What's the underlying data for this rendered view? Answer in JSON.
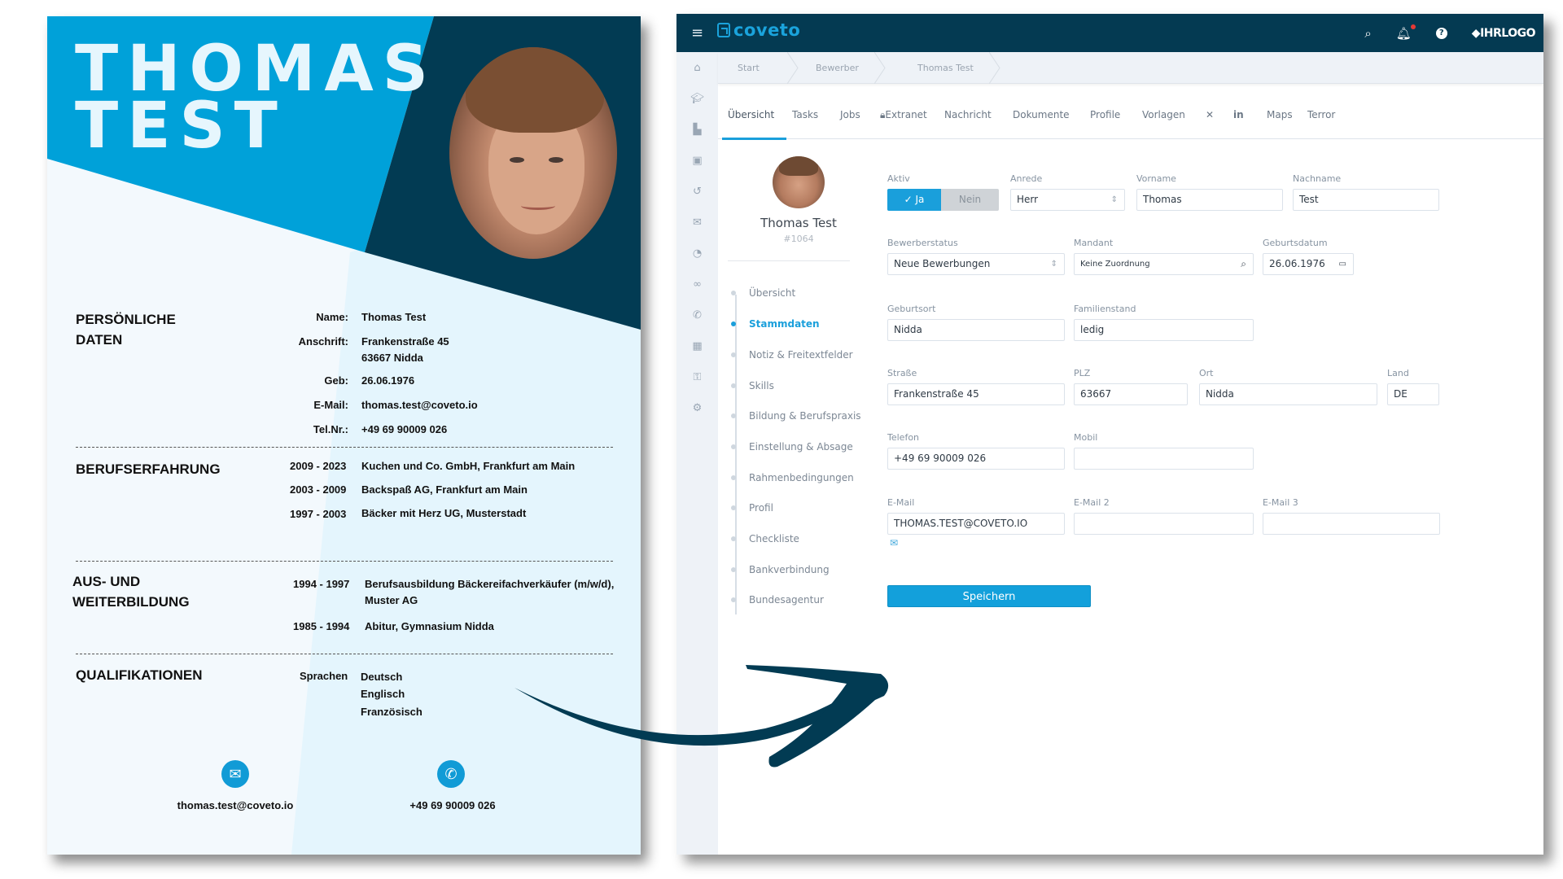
{
  "cv": {
    "first_name": "THOMAS",
    "last_name": "TEST",
    "colors": {
      "light_blue": "#00a1d9",
      "navy": "#023b53",
      "page_bg": "#f3f9fd",
      "pale": "#e4f5fd"
    },
    "personal": {
      "title_line1": "PERSÖNLICHE",
      "title_line2": "DATEN",
      "rows": [
        {
          "label": "Name:",
          "value": "Thomas Test"
        },
        {
          "label": "Anschrift:",
          "value": "Frankenstraße 45",
          "value2": "63667 Nidda"
        },
        {
          "label": "Geb:",
          "value": "26.06.1976"
        },
        {
          "label": "E-Mail:",
          "value": "thomas.test@coveto.io"
        },
        {
          "label": "Tel.Nr.:",
          "value": "+49 69 90009 026"
        }
      ]
    },
    "experience": {
      "title": "BERUFSERFAHRUNG",
      "rows": [
        {
          "years": "2009 - 2023",
          "text": "Kuchen und Co. GmbH, Frankfurt am Main"
        },
        {
          "years": "2003 - 2009",
          "text": "Backspaß AG, Frankfurt am Main"
        },
        {
          "years": "1997 - 2003",
          "text": "Bäcker mit Herz UG, Musterstadt"
        }
      ]
    },
    "education": {
      "title_line1": "AUS- UND",
      "title_line2": "WEITERBILDUNG",
      "rows": [
        {
          "years": "1994 - 1997",
          "text": "Berufsausbildung Bäckereifachverkäufer (m/w/d),",
          "text2": "Muster AG"
        },
        {
          "years": "1985 - 1994",
          "text": "Abitur, Gymnasium Nidda"
        }
      ]
    },
    "qualifications": {
      "title": "QUALIFIKATIONEN",
      "label": "Sprachen",
      "languages": [
        "Deutsch",
        "Englisch",
        "Französisch"
      ]
    },
    "footer": {
      "email_icon": "envelope-icon",
      "email": "thomas.test@coveto.io",
      "phone_icon": "phone-icon",
      "phone": "+49 69 90009 026"
    }
  },
  "app": {
    "brand": "coveto",
    "header_icons": [
      "menu-icon",
      "search-icon",
      "bell-icon",
      "help-icon"
    ],
    "customer_logo": "IHRLOGO",
    "colors": {
      "header": "#043a52",
      "accent": "#1a9fdb",
      "sidebar": "#eef2f7"
    },
    "sidebar_icons": [
      "home-icon",
      "graduation-cap-icon",
      "factory-icon",
      "contact-card-icon",
      "history-icon",
      "envelope-icon",
      "pie-chart-icon",
      "link-icon",
      "phone-icon",
      "calendar-icon",
      "user-lock-icon",
      "gears-icon"
    ],
    "breadcrumb": [
      "Start",
      "Bewerber",
      "Thomas Test"
    ],
    "tabs": [
      {
        "label": "Übersicht",
        "active": true
      },
      {
        "label": "Tasks"
      },
      {
        "label": "Jobs"
      },
      {
        "label": "Extranet",
        "icon": "lock-icon"
      },
      {
        "label": "Nachricht"
      },
      {
        "label": "Dokumente"
      },
      {
        "label": "Profile"
      },
      {
        "label": "Vorlagen"
      },
      {
        "label": "",
        "icon": "xing-icon"
      },
      {
        "label": "in",
        "icon": "linkedin-icon"
      },
      {
        "label": "Maps"
      },
      {
        "label": "Terror"
      }
    ],
    "profile": {
      "name": "Thomas Test",
      "id": "#1064"
    },
    "subnav": [
      {
        "label": "Übersicht"
      },
      {
        "label": "Stammdaten",
        "active": true
      },
      {
        "label": "Notiz & Freitextfelder"
      },
      {
        "label": "Skills"
      },
      {
        "label": "Bildung & Berufspraxis"
      },
      {
        "label": "Einstellung & Absage"
      },
      {
        "label": "Rahmenbedingungen"
      },
      {
        "label": "Profil"
      },
      {
        "label": "Checkliste"
      },
      {
        "label": "Bankverbindung"
      },
      {
        "label": "Bundesagentur"
      }
    ],
    "form": {
      "aktiv": {
        "label": "Aktiv",
        "yes": "Ja",
        "no": "Nein",
        "value": "Ja"
      },
      "anrede": {
        "label": "Anrede",
        "value": "Herr"
      },
      "vorname": {
        "label": "Vorname",
        "value": "Thomas"
      },
      "nachname": {
        "label": "Nachname",
        "value": "Test"
      },
      "bewerberstatus": {
        "label": "Bewerberstatus",
        "value": "Neue Bewerbungen"
      },
      "mandant": {
        "label": "Mandant",
        "value": "Keine Zuordnung"
      },
      "geburtsdatum": {
        "label": "Geburtsdatum",
        "value": "26.06.1976"
      },
      "geburtsort": {
        "label": "Geburtsort",
        "value": "Nidda"
      },
      "familienstand": {
        "label": "Familienstand",
        "value": "ledig"
      },
      "strasse": {
        "label": "Straße",
        "value": "Frankenstraße 45"
      },
      "plz": {
        "label": "PLZ",
        "value": "63667"
      },
      "ort": {
        "label": "Ort",
        "value": "Nidda"
      },
      "land": {
        "label": "Land",
        "value": "DE"
      },
      "telefon": {
        "label": "Telefon",
        "value": "+49 69 90009 026"
      },
      "mobil": {
        "label": "Mobil",
        "value": ""
      },
      "email": {
        "label": "E-Mail",
        "value": "THOMAS.TEST@COVETO.IO"
      },
      "email2": {
        "label": "E-Mail 2",
        "value": ""
      },
      "email3": {
        "label": "E-Mail 3",
        "value": ""
      },
      "save_label": "Speichern"
    }
  }
}
